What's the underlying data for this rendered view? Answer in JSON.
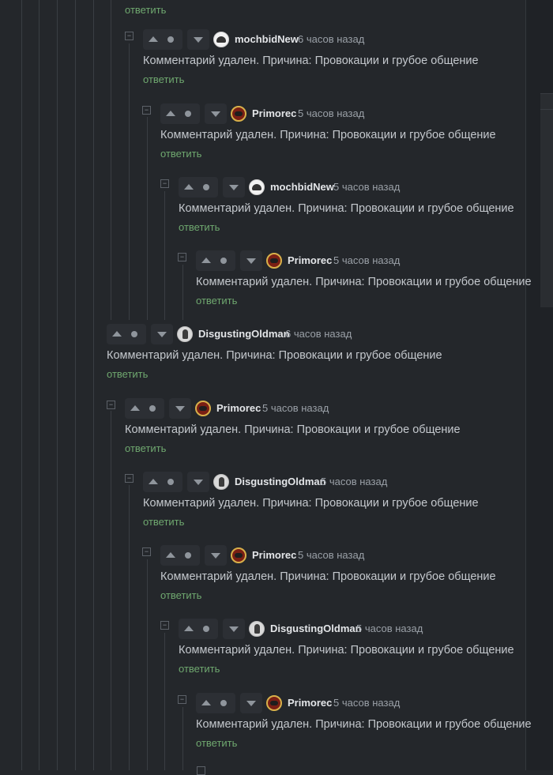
{
  "colors": {
    "background": "#24272b",
    "text": "#c4c8cd",
    "username": "#e3e5e8",
    "muted": "#9aa0a7",
    "reply": "#6fa86f"
  },
  "top_reply_label": "ответить",
  "comments": [
    {
      "username": "mochbidNew",
      "time": "6 часов назад",
      "text": "Комментарий удален. Причина: Провокации и грубое общение",
      "reply": "ответить",
      "avatar": "mochbid-avatar-icon"
    },
    {
      "username": "Primorec",
      "time": "5 часов назад",
      "text": "Комментарий удален. Причина: Провокации и грубое общение",
      "reply": "ответить",
      "avatar": "primorec-avatar-icon"
    },
    {
      "username": "mochbidNew",
      "time": "5 часов назад",
      "text": "Комментарий удален. Причина: Провокации и грубое общение",
      "reply": "ответить",
      "avatar": "mochbid-avatar-icon"
    },
    {
      "username": "Primorec",
      "time": "5 часов назад",
      "text": "Комментарий удален. Причина: Провокации и грубое общение",
      "reply": "ответить",
      "avatar": "primorec-avatar-icon"
    },
    {
      "username": "DisgustingOldman",
      "time": "6 часов назад",
      "text": "Комментарий удален. Причина: Провокации и грубое общение",
      "reply": "ответить",
      "avatar": "disgusting-avatar-icon"
    },
    {
      "username": "Primorec",
      "time": "5 часов назад",
      "text": "Комментарий удален. Причина: Провокации и грубое общение",
      "reply": "ответить",
      "avatar": "primorec-avatar-icon"
    },
    {
      "username": "DisgustingOldman",
      "time": "5 часов назад",
      "text": "Комментарий удален. Причина: Провокации и грубое общение",
      "reply": "ответить",
      "avatar": "disgusting-avatar-icon"
    },
    {
      "username": "Primorec",
      "time": "5 часов назад",
      "text": "Комментарий удален. Причина: Провокации и грубое общение",
      "reply": "ответить",
      "avatar": "primorec-avatar-icon"
    },
    {
      "username": "DisgustingOldman",
      "time": "5 часов назад",
      "text": "Комментарий удален. Причина: Провокации и грубое общение",
      "reply": "ответить",
      "avatar": "disgusting-avatar-icon"
    },
    {
      "username": "Primorec",
      "time": "5 часов назад",
      "text": "Комментарий удален. Причина: Провокации и грубое общение",
      "reply": "ответить",
      "avatar": "primorec-avatar-icon"
    }
  ]
}
